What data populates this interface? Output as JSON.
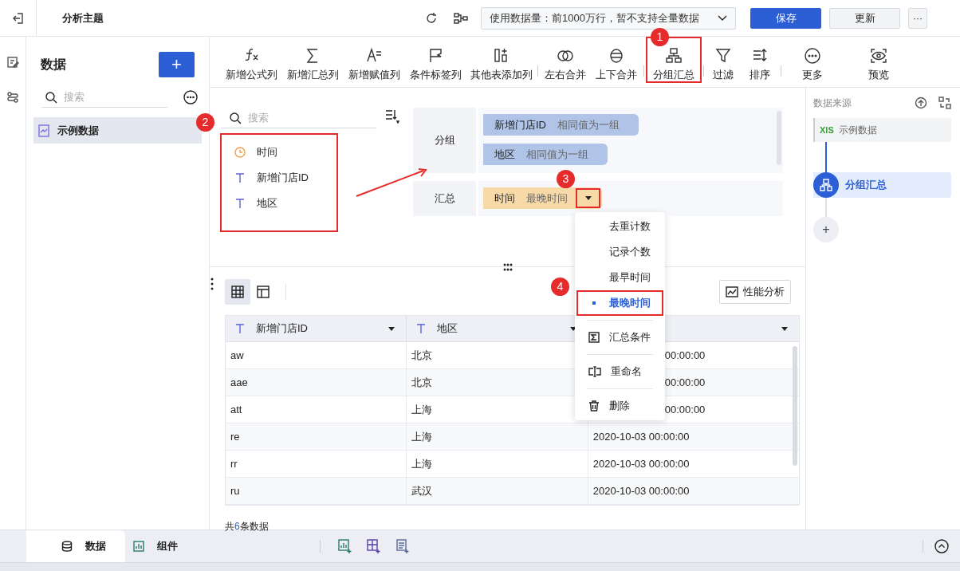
{
  "topbar": {
    "title": "分析主题",
    "data_limit": "使用数据量：前1000万行，暂不支持全量数据",
    "buttons": [
      {
        "label": "保存",
        "kind": "primary"
      },
      {
        "label": "更新",
        "kind": "secondary"
      }
    ],
    "more": "···"
  },
  "data_panel": {
    "title": "数据",
    "add": "+",
    "search": {
      "placeholder": "搜索"
    },
    "items": [
      {
        "label": "示例数据",
        "selected": true
      }
    ]
  },
  "toolbar": [
    {
      "label": "新增公式列",
      "highlighted": false
    },
    {
      "label": "新增汇总列",
      "highlighted": false
    },
    {
      "label": "新增赋值列",
      "highlighted": false
    },
    {
      "label": "条件标签列",
      "highlighted": false
    },
    {
      "label": "其他表添加列",
      "highlighted": false
    },
    {
      "label": "左右合并",
      "highlighted": false
    },
    {
      "label": "上下合并",
      "highlighted": false
    },
    {
      "label": "分组汇总",
      "highlighted": true
    },
    {
      "label": "过滤",
      "highlighted": false
    },
    {
      "label": "排序",
      "highlighted": false
    },
    {
      "label": "更多",
      "highlighted": false
    },
    {
      "label": "预览",
      "highlighted": false
    }
  ],
  "fields": {
    "search": {
      "placeholder": "搜索"
    },
    "highlighted": true,
    "items": [
      {
        "label": "时间",
        "kind": "time"
      },
      {
        "label": "新增门店ID",
        "kind": "text"
      },
      {
        "label": "地区",
        "kind": "text"
      }
    ]
  },
  "group": {
    "label": "分组",
    "chips": [
      {
        "field": "新增门店ID",
        "rule": "相同值为一组"
      },
      {
        "field": "地区",
        "rule": "相同值为一组"
      }
    ]
  },
  "summary": {
    "label": "汇总",
    "chips": [
      {
        "field": "时间",
        "rule": "最晚时间",
        "caret_highlighted": true
      }
    ]
  },
  "menu": [
    {
      "label": "去重计数",
      "kind": "option",
      "selected": false,
      "highlighted": false
    },
    {
      "label": "记录个数",
      "kind": "option",
      "selected": false,
      "highlighted": false
    },
    {
      "label": "最早时间",
      "kind": "option",
      "selected": false,
      "highlighted": false
    },
    {
      "label": "最晚时间",
      "kind": "option",
      "selected": true,
      "highlighted": true
    },
    {
      "label": "汇总条件",
      "kind": "condition",
      "selected": false,
      "highlighted": false
    },
    {
      "label": "重命名",
      "kind": "rename",
      "selected": false,
      "highlighted": false
    },
    {
      "label": "删除",
      "kind": "delete",
      "selected": false,
      "highlighted": false
    }
  ],
  "preview": {
    "views": [
      {
        "kind": "grid",
        "selected": true
      },
      {
        "kind": "layout",
        "selected": false
      }
    ],
    "perf_button": "性能分析",
    "table": {
      "columns": [
        {
          "label": "新增门店ID",
          "kind": "text"
        },
        {
          "label": "地区",
          "kind": "text"
        },
        {
          "kind": "covered"
        }
      ],
      "rows": [
        {
          "cells": [
            "aw",
            "北京",
            "00:00:00"
          ],
          "partial": true
        },
        {
          "cells": [
            "aae",
            "北京",
            "00:00:00"
          ],
          "partial": true
        },
        {
          "cells": [
            "att",
            "上海",
            "00:00:00"
          ],
          "partial": true
        },
        {
          "cells": [
            "re",
            "上海",
            "2020-10-03 00:00:00"
          ],
          "partial": false
        },
        {
          "cells": [
            "rr",
            "上海",
            "2020-10-03 00:00:00"
          ],
          "partial": false
        },
        {
          "cells": [
            "ru",
            "武汉",
            "2020-10-03 00:00:00"
          ],
          "partial": false
        }
      ]
    },
    "count": "共**6**条数据"
  },
  "source_panel": {
    "title": "数据来源",
    "source": {
      "badge": "XlS",
      "label": "示例数据"
    },
    "steps": [
      {
        "label": "分组汇总",
        "selected": true
      }
    ],
    "add": "+"
  },
  "bottom_tabs": [
    {
      "label": "数据",
      "selected": true
    },
    {
      "label": "组件",
      "selected": false
    }
  ],
  "annotations": [
    {
      "number": "1"
    },
    {
      "number": "2"
    },
    {
      "number": "3"
    },
    {
      "number": "4"
    }
  ]
}
